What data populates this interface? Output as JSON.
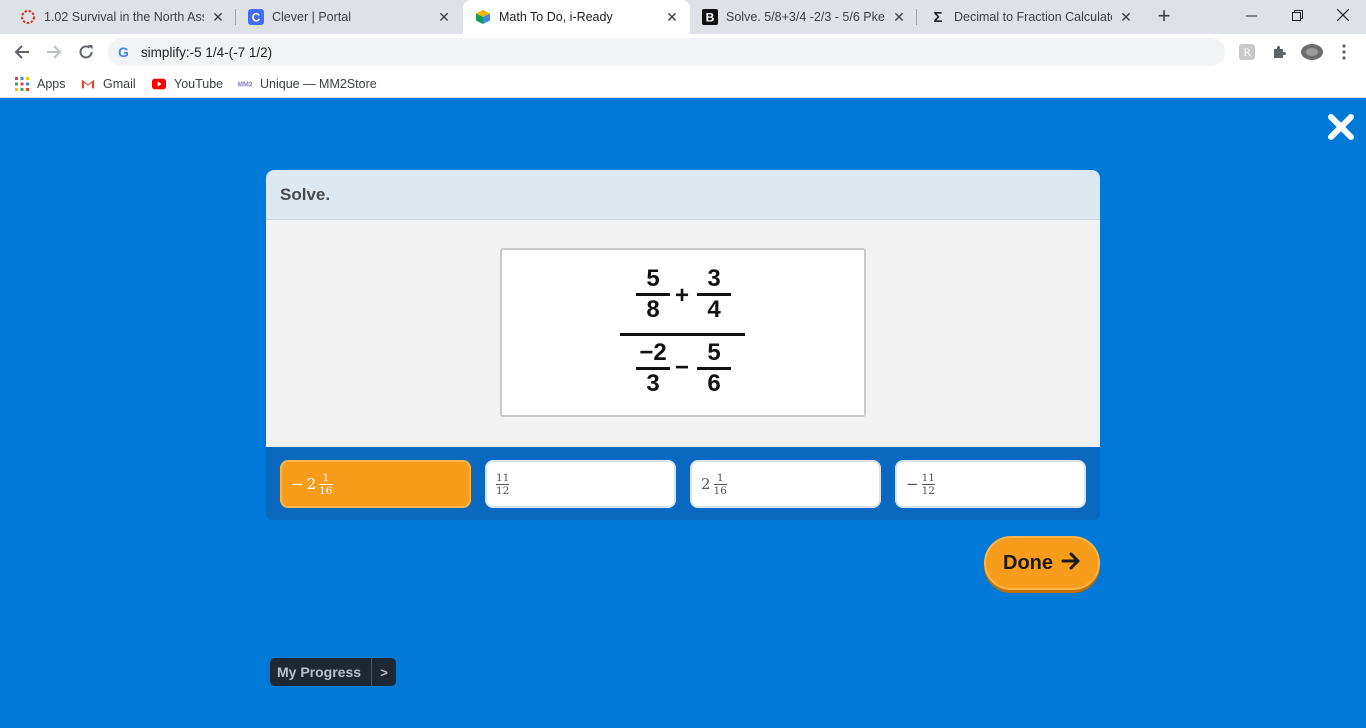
{
  "browser": {
    "tabs": [
      {
        "title": "1.02 Survival in the North Asse",
        "icon": "circle-dots-icon"
      },
      {
        "title": "Clever | Portal",
        "icon": "clever-logo-icon"
      },
      {
        "title": "Math To Do, i-Ready",
        "icon": "iready-cube-icon",
        "active": true
      },
      {
        "title": "Solve. 5/8+3/4 -2/3 - 5/6 Pkea",
        "icon": "brainly-icon"
      },
      {
        "title": "Decimal to Fraction Calculator",
        "icon": "sigma-icon"
      }
    ],
    "address": "simplify:-5 1/4-(-7 1/2)",
    "bookmarks": [
      {
        "label": "Apps",
        "icon": "apps-grid-icon"
      },
      {
        "label": "Gmail",
        "icon": "gmail-icon"
      },
      {
        "label": "YouTube",
        "icon": "youtube-icon"
      },
      {
        "label": "Unique — MM2Store",
        "icon": "mm2store-icon"
      }
    ]
  },
  "question": {
    "prompt": "Solve.",
    "expression": {
      "top_left": {
        "num": "5",
        "den": "8"
      },
      "top_op": "+",
      "top_right": {
        "num": "3",
        "den": "4"
      },
      "bottom_left": {
        "num": "−2",
        "den": "3"
      },
      "bottom_op": "−",
      "bottom_right": {
        "num": "5",
        "den": "6"
      }
    }
  },
  "choices": [
    {
      "sign": "−",
      "whole": "2",
      "num": "1",
      "den": "16",
      "selected": true
    },
    {
      "sign": "",
      "whole": "",
      "num": "11",
      "den": "12",
      "selected": false
    },
    {
      "sign": "",
      "whole": "2",
      "num": "1",
      "den": "16",
      "selected": false
    },
    {
      "sign": "−",
      "whole": "",
      "num": "11",
      "den": "12",
      "selected": false
    }
  ],
  "done_label": "Done",
  "progress_label": "My Progress",
  "progress_arrow": ">",
  "colors": {
    "background": "#0179d8",
    "accent_orange": "#f89c1c",
    "answer_bar": "#0a69bf"
  }
}
